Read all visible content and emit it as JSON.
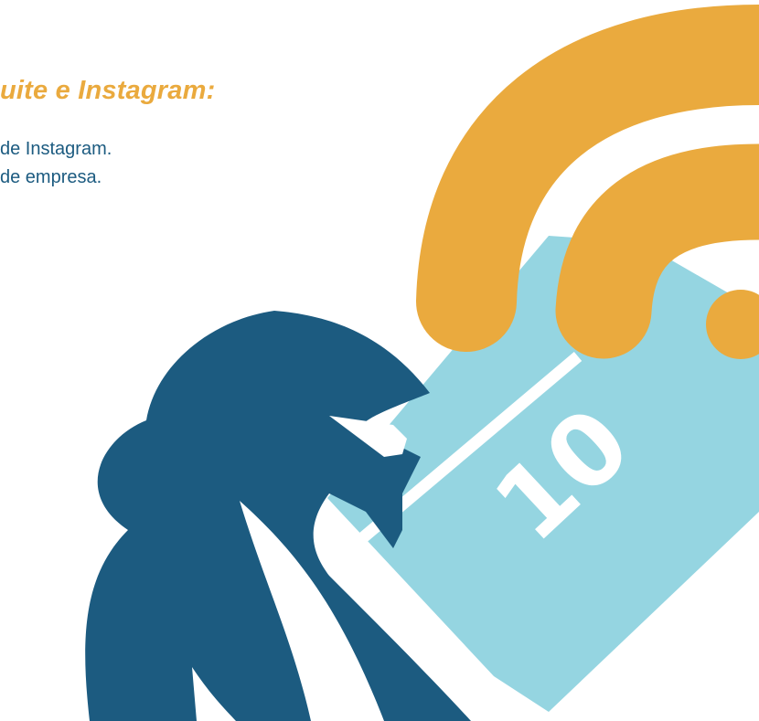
{
  "heading": "uite e Instagram:",
  "lines": [
    "de Instagram.",
    "de empresa."
  ],
  "illustration": {
    "ticket_number": "10",
    "colors": {
      "hand": "#1c5b80",
      "ticket": "#95d5e1",
      "wifi": "#eaaa3e",
      "text_heading": "#eaaa3e",
      "text_body": "#1c5b80"
    },
    "icons": [
      "hand-icon",
      "ticket-icon",
      "wifi-signal-icon"
    ]
  }
}
